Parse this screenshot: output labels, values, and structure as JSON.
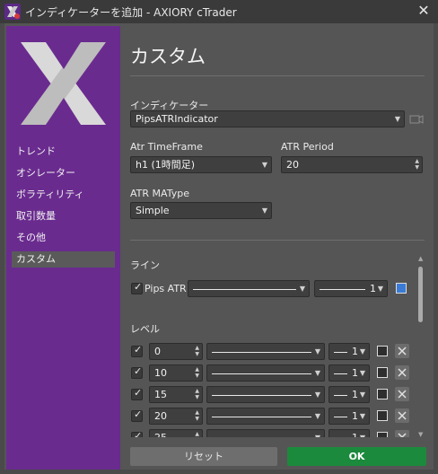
{
  "window": {
    "title": "インディケーターを追加 - AXIORY cTrader"
  },
  "sidebar": {
    "items": [
      {
        "label": "トレンド",
        "active": false
      },
      {
        "label": "オシレーター",
        "active": false
      },
      {
        "label": "ボラティリティ",
        "active": false
      },
      {
        "label": "取引数量",
        "active": false
      },
      {
        "label": "その他",
        "active": false
      },
      {
        "label": "カスタム",
        "active": true
      }
    ]
  },
  "panel": {
    "heading": "カスタム",
    "indicator": {
      "label": "インディケーター",
      "value": "PipsATRIndicator"
    },
    "atr_timeframe": {
      "label": "Atr TimeFrame",
      "value": "h1 (1時間足)"
    },
    "atr_period": {
      "label": "ATR Period",
      "value": "20"
    },
    "atr_matype": {
      "label": "ATR MAType",
      "value": "Simple"
    },
    "lines_section": {
      "label": "ライン"
    },
    "line": {
      "name": "Pips ATR",
      "checked": true,
      "thickness": "1",
      "color": "#3a7bd5"
    },
    "levels_section": {
      "label": "レベル"
    },
    "levels": [
      {
        "value": "0",
        "checked": true,
        "thickness": "1"
      },
      {
        "value": "10",
        "checked": true,
        "thickness": "1"
      },
      {
        "value": "15",
        "checked": true,
        "thickness": "1"
      },
      {
        "value": "20",
        "checked": true,
        "thickness": "1"
      },
      {
        "value": "25",
        "checked": true,
        "thickness": "1"
      }
    ]
  },
  "footer": {
    "reset_label": "リセット",
    "ok_label": "OK"
  },
  "colors": {
    "sidebar": "#6a2b8f",
    "ok_button": "#1c8a3c",
    "reset_button": "#6e6e6e",
    "line_color": "#3a7bd5"
  },
  "icons": {
    "app": "axiory-app-icon",
    "close": "close-icon",
    "logo": "axiory-x-logo",
    "chart_toggle": "chart-icon",
    "remove": "remove-level-icon"
  }
}
